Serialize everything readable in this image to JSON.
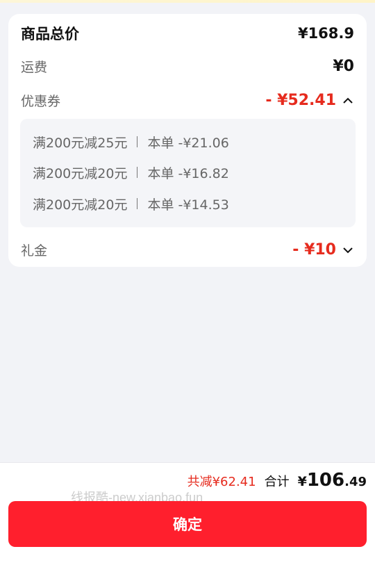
{
  "summary_card": {
    "total_label": "商品总价",
    "total_value": "¥168.9",
    "shipping_label": "运费",
    "shipping_value": "¥0",
    "coupon_label": "优惠券",
    "coupon_value": "- ¥52.41",
    "coupon_expanded": true,
    "coupons": [
      {
        "rule": "满200元减25元",
        "deduction": "本单 -¥21.06"
      },
      {
        "rule": "满200元减20元",
        "deduction": "本单 -¥16.82"
      },
      {
        "rule": "满200元减20元",
        "deduction": "本单 -¥14.53"
      }
    ],
    "gift_label": "礼金",
    "gift_value": "- ¥10"
  },
  "footer": {
    "discount_text": "共减¥62.41",
    "total_label": "合计",
    "total_currency": "¥",
    "total_int": "106",
    "total_dec": ".49",
    "watermark": "线报酷-new.xianbao.fun",
    "confirm_label": "确定"
  },
  "colors": {
    "accent_red": "#e62b1e",
    "button_red": "#ff1f2d",
    "background": "#f2f3f7"
  },
  "icons": {
    "coupon_toggle": "chevron-up-icon",
    "gift_toggle": "chevron-down-icon"
  }
}
